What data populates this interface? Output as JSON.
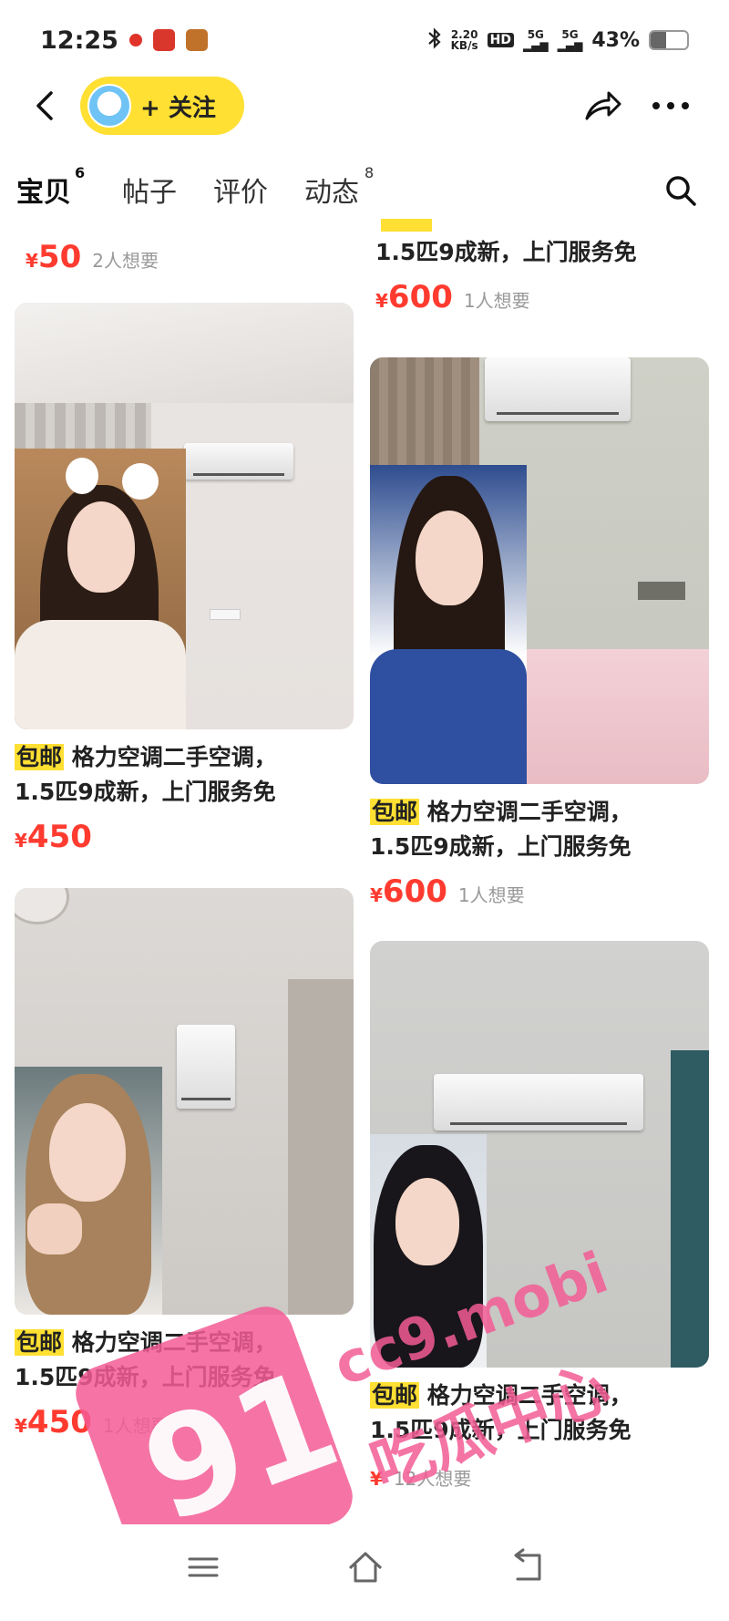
{
  "status_bar": {
    "time": "12:25",
    "net_speed_value": "2.20",
    "net_speed_unit": "KB/s",
    "hd_label": "HD",
    "sim_labels": [
      "5G",
      "5G"
    ],
    "battery_percent": 43,
    "battery_label": "43%"
  },
  "nav": {
    "follow_label": "+ 关注"
  },
  "tabs": [
    {
      "label": "宝贝",
      "sup": "6",
      "active": true
    },
    {
      "label": "帖子",
      "sup": ""
    },
    {
      "label": "评价",
      "sup": ""
    },
    {
      "label": "动态",
      "sup": "8"
    }
  ],
  "top_partial": {
    "left": {
      "price": "50",
      "wants": "2人想要"
    },
    "right": {
      "title_line": "1.5匹9成新，上门服务免",
      "price": "600",
      "wants": "1人想要"
    }
  },
  "items": [
    {
      "tag": "包邮",
      "title_a": "格力空调二手空调，",
      "title_b": "1.5匹9成新，上门服务免",
      "price": "450",
      "wants": ""
    },
    {
      "tag": "包邮",
      "title_a": "格力空调二手空调，",
      "title_b": "1.5匹9成新，上门服务免",
      "price": "600",
      "wants": "1人想要"
    },
    {
      "tag": "包邮",
      "title_a": "格力空调二手空调，",
      "title_b": "1.5匹9成新，上门服务免",
      "price": "450",
      "wants": "1人想要"
    },
    {
      "tag": "包邮",
      "title_a": "格力空调二手空调，",
      "title_b": "1.5匹9成新，上门服务免",
      "price": "",
      "wants": "12人想要"
    }
  ],
  "currency": "¥",
  "watermark": {
    "number": "91",
    "domain": "cc9.mobi",
    "text": "吃瓜中心"
  },
  "colors": {
    "accent_yellow": "#ffe033",
    "price_red": "#ff3b30",
    "watermark_pink": "#f35c95"
  }
}
